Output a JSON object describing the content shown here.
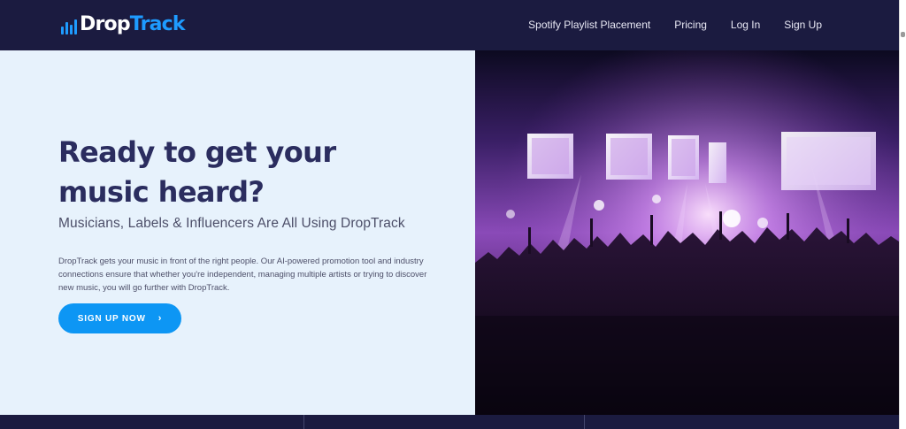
{
  "brand": {
    "name_part1": "Drop",
    "name_part2": "Track",
    "accent_color": "#1e9bff",
    "navy_color": "#1b1b40"
  },
  "nav": {
    "items": [
      {
        "label": "Spotify Playlist Placement"
      },
      {
        "label": "Pricing"
      },
      {
        "label": "Log In"
      },
      {
        "label": "Sign Up"
      }
    ]
  },
  "hero": {
    "title": "Ready to get your music heard?",
    "subtitle": "Musicians, Labels & Influencers Are All Using DropTrack",
    "body": "DropTrack gets your music in front of the right people. Our AI-powered promotion tool and industry connections ensure that whether you're independent, managing multiple artists or trying to discover new music, you will go further with DropTrack.",
    "cta_label": "SIGN UP NOW",
    "cta_color": "#0d96f4",
    "image_icon": "concert-crowd-image"
  }
}
